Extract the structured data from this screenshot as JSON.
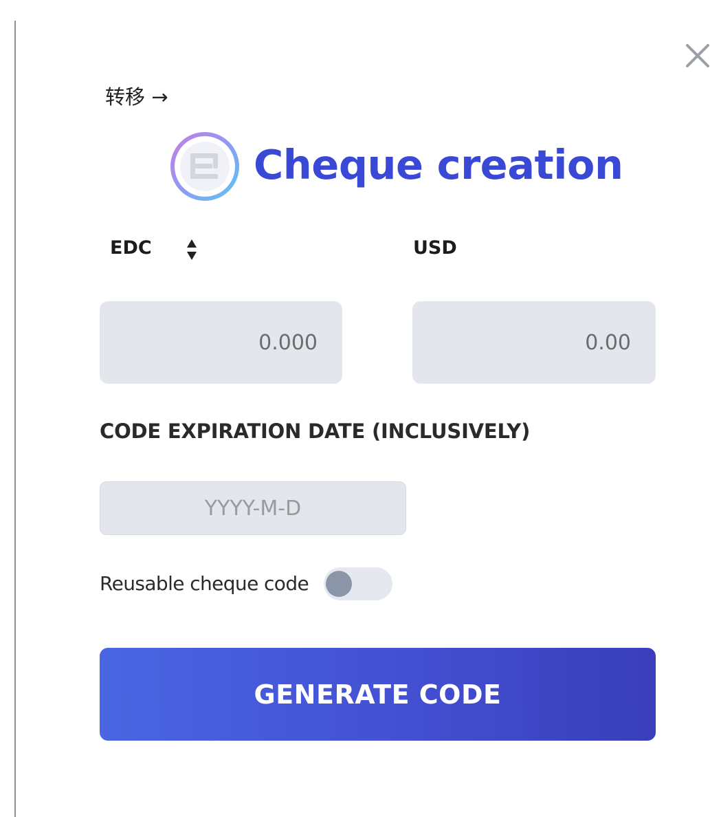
{
  "dialog": {
    "close_icon": "close-icon",
    "transfer_link_label": "转移 →",
    "title": "Cheque creation",
    "logo_icon": "edc-coin-logo-icon"
  },
  "currency": {
    "from_label": "EDC",
    "swap_icon": "sort-updown-icon",
    "to_label": "USD"
  },
  "amount": {
    "edc_placeholder": "0.000",
    "usd_placeholder": "0.00"
  },
  "expiration": {
    "label": "CODE EXPIRATION DATE (INCLUSIVELY)",
    "placeholder": "YYYY-M-D"
  },
  "reusable": {
    "label": "Reusable cheque code",
    "enabled": false
  },
  "actions": {
    "generate_label": "GENERATE CODE"
  },
  "colors": {
    "title": "#3a48d6",
    "button_start": "#4a66e2",
    "button_end": "#3a3eba",
    "field_bg": "#e4e6ee",
    "toggle_knob": "#8a96a8"
  }
}
